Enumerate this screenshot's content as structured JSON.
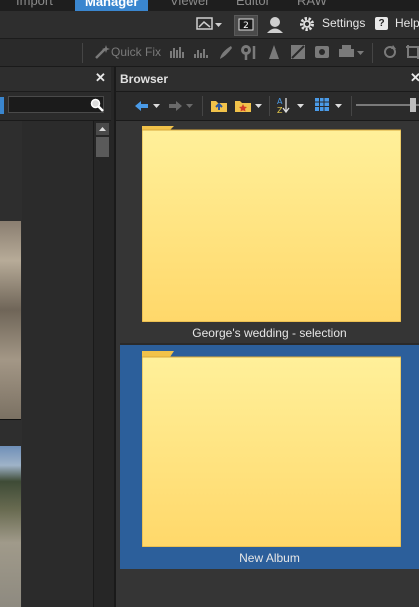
{
  "modes": [
    {
      "label": "Import",
      "active": false
    },
    {
      "label": "Manager",
      "active": true
    },
    {
      "label": "Viewer",
      "active": false
    },
    {
      "label": "Editor",
      "active": false
    },
    {
      "label": "RAW",
      "active": false
    }
  ],
  "top_bar": {
    "settings_label": "Settings",
    "help_label": "Help",
    "display_badge": "2"
  },
  "quick_fix": {
    "label": "Quick Fix"
  },
  "left_panel": {
    "close_symbol": "✕",
    "search_placeholder": ""
  },
  "browser": {
    "title": "Browser",
    "close_symbol": "✕",
    "items": [
      {
        "label": "George's wedding - selection",
        "selected": false
      },
      {
        "label": "New Album",
        "selected": true
      }
    ]
  },
  "colors": {
    "accent": "#3a86cf",
    "selection": "#2c5f9b",
    "folder": "#ffd96e"
  }
}
